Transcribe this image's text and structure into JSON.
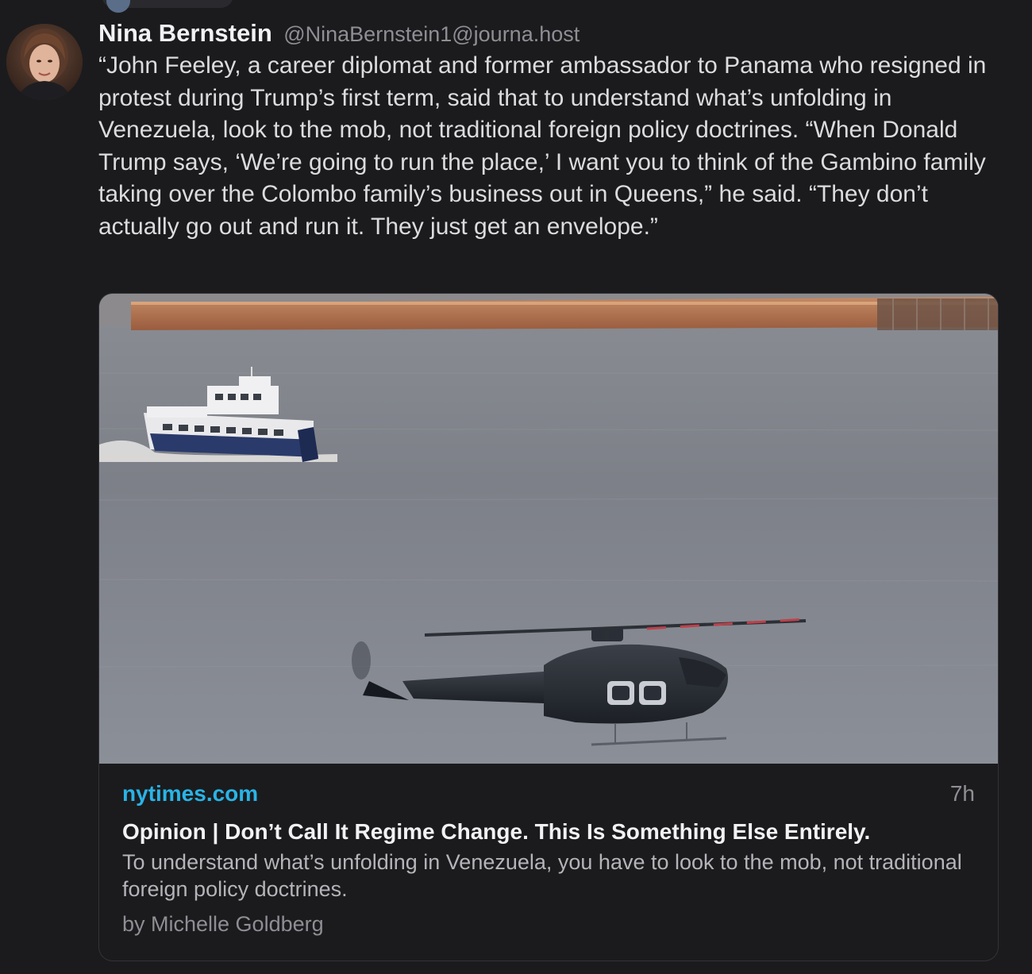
{
  "post": {
    "author": {
      "display_name": "Nina Bernstein",
      "handle": "@NinaBernstein1@journa.host"
    },
    "text": "“John Feeley, a career diplomat and former ambassador to Panama who resigned in protest during Trump’s first term, said that to understand what’s unfolding in Venezuela, look to the mob, not traditional foreign policy doctrines. “When Donald Trump says, ‘We’re going to run the place,’ I want you to think of the Gambino family taking over the Colombo family’s business out in Queens,” he said. “They don’t actually go out and run it. They just get an envelope.”"
  },
  "link_card": {
    "source": "nytimes.com",
    "time": "7h",
    "title": "Opinion | Don’t Call It Regime Change. This Is Something Else Entirely.",
    "description": "To understand what’s unfolding in Venezuela, you have to look to the mob, not traditional foreign policy doctrines.",
    "byline": "by Michelle Goldberg"
  },
  "colors": {
    "background": "#1b1b1d",
    "link_source": "#2ab3e6",
    "muted_text": "#8e8e94",
    "card_border": "#333338"
  }
}
